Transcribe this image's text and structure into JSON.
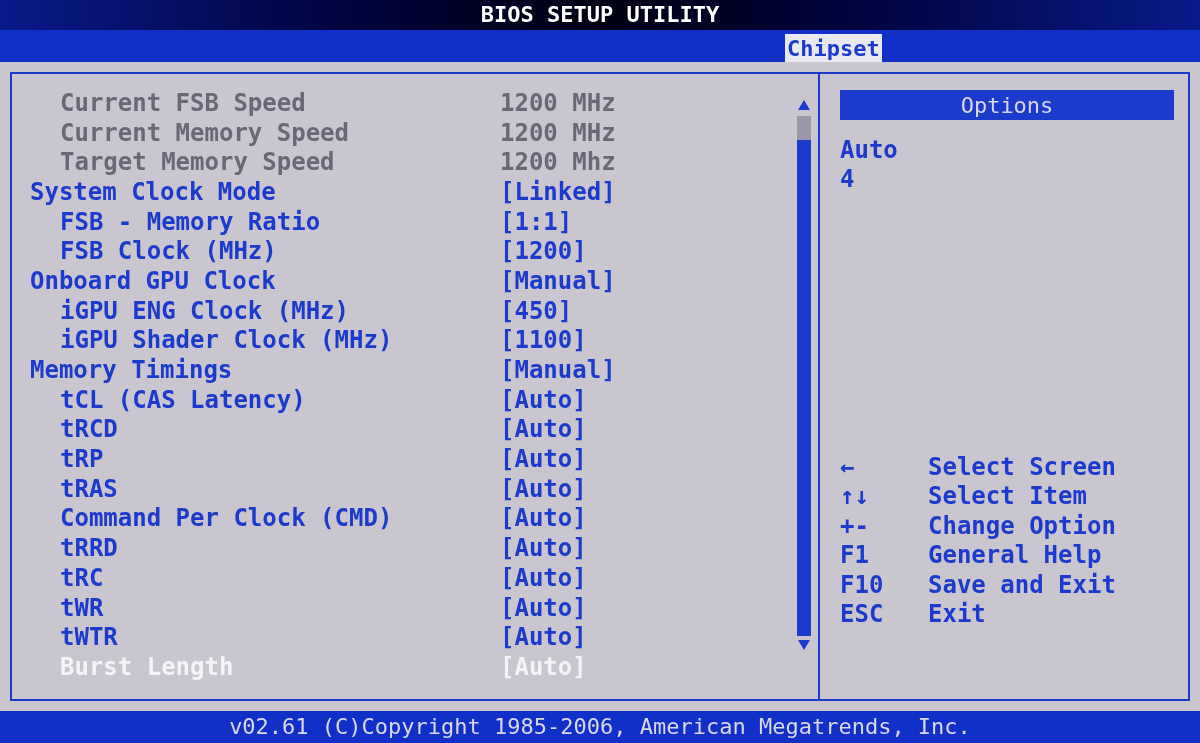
{
  "window": {
    "title": "BIOS SETUP UTILITY"
  },
  "tabs": [
    {
      "label": "Chipset",
      "selected": true
    }
  ],
  "settings": [
    {
      "kind": "info",
      "label": "Current FSB Speed",
      "value": "1200 MHz",
      "selected": false
    },
    {
      "kind": "info",
      "label": "Current Memory Speed",
      "value": "1200 MHz",
      "selected": false
    },
    {
      "kind": "info",
      "label": "Target Memory Speed",
      "value": "1200 Mhz",
      "selected": false
    },
    {
      "kind": "setting",
      "label": "System Clock Mode",
      "value": "[Linked]",
      "selected": false,
      "children": [
        {
          "kind": "setting",
          "label": "FSB - Memory Ratio",
          "value": "[1:1]",
          "selected": false
        },
        {
          "kind": "setting",
          "label": "FSB Clock (MHz)",
          "value": "[1200]",
          "selected": false
        }
      ]
    },
    {
      "kind": "setting",
      "label": "Onboard GPU Clock",
      "value": "[Manual]",
      "selected": false,
      "children": [
        {
          "kind": "setting",
          "label": "iGPU ENG Clock (MHz)",
          "value": "[450]",
          "selected": false
        },
        {
          "kind": "setting",
          "label": "iGPU Shader Clock (MHz)",
          "value": "[1100]",
          "selected": false
        }
      ]
    },
    {
      "kind": "setting",
      "label": "Memory Timings",
      "value": "[Manual]",
      "selected": false,
      "children": [
        {
          "kind": "setting",
          "label": "tCL (CAS Latency)",
          "value": "[Auto]",
          "selected": false
        },
        {
          "kind": "setting",
          "label": "tRCD",
          "value": "[Auto]",
          "selected": false
        },
        {
          "kind": "setting",
          "label": "tRP",
          "value": "[Auto]",
          "selected": false
        },
        {
          "kind": "setting",
          "label": "tRAS",
          "value": "[Auto]",
          "selected": false
        },
        {
          "kind": "setting",
          "label": "Command Per Clock (CMD)",
          "value": "[Auto]",
          "selected": false
        },
        {
          "kind": "setting",
          "label": "tRRD",
          "value": "[Auto]",
          "selected": false
        },
        {
          "kind": "setting",
          "label": "tRC",
          "value": "[Auto]",
          "selected": false
        },
        {
          "kind": "setting",
          "label": "tWR",
          "value": "[Auto]",
          "selected": false
        },
        {
          "kind": "setting",
          "label": "tWTR",
          "value": "[Auto]",
          "selected": false
        },
        {
          "kind": "setting",
          "label": "Burst Length",
          "value": "[Auto]",
          "selected": true
        }
      ]
    }
  ],
  "options": {
    "title": "Options",
    "items": [
      "Auto",
      "4"
    ]
  },
  "keys": [
    {
      "key": "←",
      "action": "Select Screen"
    },
    {
      "key": "↑↓",
      "action": "Select Item"
    },
    {
      "key": "+-",
      "action": "Change Option"
    },
    {
      "key": "F1",
      "action": "General Help"
    },
    {
      "key": "F10",
      "action": "Save and Exit"
    },
    {
      "key": "ESC",
      "action": "Exit"
    }
  ],
  "status_bar": "v02.61 (C)Copyright 1985-2006, American Megatrends, Inc."
}
